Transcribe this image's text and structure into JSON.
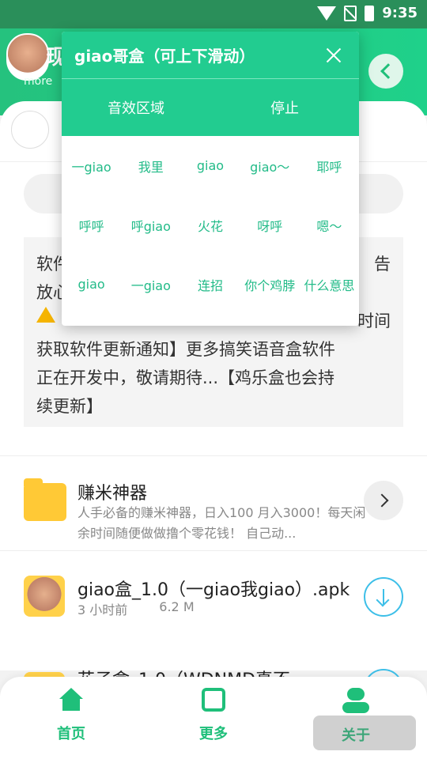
{
  "status_bar": {
    "time": "9:35"
  },
  "header": {
    "title_partial": "现",
    "subtitle_partial": "more"
  },
  "notice": {
    "line1_left": "软件",
    "line1_right": "告",
    "line2_left": "放心",
    "line3_right": "时间",
    "line4": "获取软件更新通知】更多搞笑语音盒软件",
    "line5": "正在开发中，敬请期待...【鸡乐盒也会持",
    "line6": "续更新】"
  },
  "list": [
    {
      "title": "赚米神器",
      "desc": "人手必备的赚米神器，日入100 月入3000！每天闲余时间随便做做撸个零花钱！ 自己动...",
      "action_icon": "chevron-right-icon"
    },
    {
      "title": "giao盒_1.0（一giao我giao）.apk",
      "time": "3 小时前",
      "size": "6.2 M",
      "action_icon": "download-icon"
    },
    {
      "title_partial": "花子盒_1.0（WDNMD真不",
      "action_icon": "download-icon"
    }
  ],
  "popup": {
    "title": "giao哥盒（可上下滑动）",
    "tabs": [
      "音效区域",
      "停止"
    ],
    "sounds": [
      "一giao",
      "我里",
      "giao",
      "giao～",
      "耶呼",
      "呼呼",
      "呼giao",
      "火花",
      "呀呼",
      "嗯～",
      "giao",
      "一giao",
      "连招",
      "你个鸡脖",
      "什么意思"
    ]
  },
  "bottom_nav": [
    {
      "label": "首页",
      "icon": "home-icon"
    },
    {
      "label": "更多",
      "icon": "refresh-icon"
    },
    {
      "label": "关于",
      "icon": "user-icon"
    }
  ],
  "colors": {
    "accent": "#22cc90",
    "header": "#25c27e",
    "download": "#3dbfe8",
    "folder": "#ffc936"
  }
}
